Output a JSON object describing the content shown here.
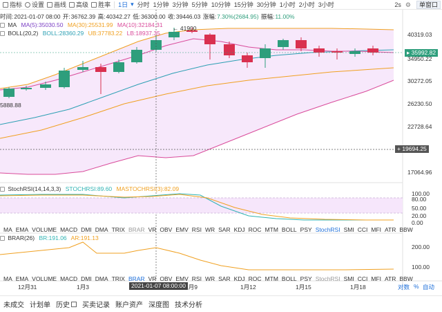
{
  "toolbar": {
    "items": [
      {
        "label": "指标",
        "icon": "indicator-icon"
      },
      {
        "label": "设置",
        "icon": "gear-icon"
      },
      {
        "label": "画线",
        "icon": "draw-line-icon"
      },
      {
        "label": "高级",
        "icon": "advanced-icon"
      },
      {
        "label": "胜率",
        "icon": "winrate-icon"
      }
    ],
    "timeframe_selected": "1日",
    "timeframes": [
      "分时",
      "1分钟",
      "3分钟",
      "5分钟",
      "10分钟",
      "15分钟",
      "30分钟",
      "1小时",
      "2小时",
      "3小时"
    ],
    "refresh_label": "2s",
    "view_label": "单窗口"
  },
  "info": {
    "time_label": "时间:",
    "time": "2021-01-07 08:00",
    "open_label": "开:",
    "open": "36762.39",
    "high_label": "高:",
    "high": "40342.27",
    "low_label": "低:",
    "low": "36300.00",
    "close_label": "收:",
    "close": "39446.03",
    "change_label": "涨幅:",
    "change": "7.30%(2684.95)",
    "amp_label": "振幅:",
    "amp": "11.00%"
  },
  "ma_legend": {
    "name": "MA",
    "v1": "MA(5):35030.50",
    "v2": "MA(30):25531.99",
    "v3": "MA(10):32184.31"
  },
  "boll_legend": {
    "name": "BOLL(20,2)",
    "v1": "BOLL:28360.29",
    "v2": "UB:37783.22",
    "v3": "LB:18937.35"
  },
  "stoch_legend": {
    "name": "StochRSI(14,14,3,3)",
    "v1": "STOCHRSI:89.60",
    "v2": "MASTOCHRSI(3):82.09"
  },
  "brar_legend": {
    "name": "BRAR(26)",
    "v1": "BR:191.06",
    "v2": "AR:191.13"
  },
  "indicator_tabs": [
    "MA",
    "EMA",
    "VOLUME",
    "MACD",
    "DMI",
    "DMA",
    "TRIX",
    "BRAR",
    "VR",
    "OBV",
    "EMV",
    "RSI",
    "WR",
    "SAR",
    "KDJ",
    "ROC",
    "MTM",
    "BOLL",
    "PSY",
    "StochRSI",
    "SMI",
    "CCI",
    "MFI",
    "ATR",
    "BBW"
  ],
  "indicator_tabs2": [
    "MA",
    "EMA",
    "VOLUME",
    "MACD",
    "DMI",
    "DMA",
    "TRIX",
    "BRAR",
    "VR",
    "OBV",
    "EMV",
    "RSI",
    "WR",
    "SAR",
    "KDJ",
    "ROC",
    "MTM",
    "BOLL",
    "PSY",
    "StochRSI",
    "SMI",
    "CCI",
    "MFI",
    "ATR",
    "BBW"
  ],
  "price_axis": [
    "40319.03",
    "34950.22",
    "30272.05",
    "26230.50",
    "22728.64",
    "17064.96"
  ],
  "current_price": "35992.82",
  "crosshair_price": "19694.25",
  "high_marker": "41900",
  "low_marker": "5888.88",
  "stoch_axis": [
    "100.00",
    "80.00",
    "50.00",
    "20.00",
    "0.00"
  ],
  "brar_axis": [
    "200.00",
    "100.00"
  ],
  "time_axis": [
    "12月31",
    "1月3",
    "1月9",
    "1月12",
    "1月15",
    "1月18"
  ],
  "crosshair_time": "2021-01-07 08:00:00",
  "axis_options": {
    "log": "对数",
    "pct": "%",
    "auto": "自动"
  },
  "bottom_tabs": [
    "未成交",
    "计划单",
    "历史",
    "买卖记录",
    "账户资产",
    "深度图",
    "技术分析"
  ],
  "colors": {
    "up": "#2e9e7c",
    "down": "#d9304f",
    "ma5": "#7b3fc4",
    "ma30": "#f0a020",
    "ma10": "#d94a9a",
    "accent": "#1e6fd9"
  }
}
